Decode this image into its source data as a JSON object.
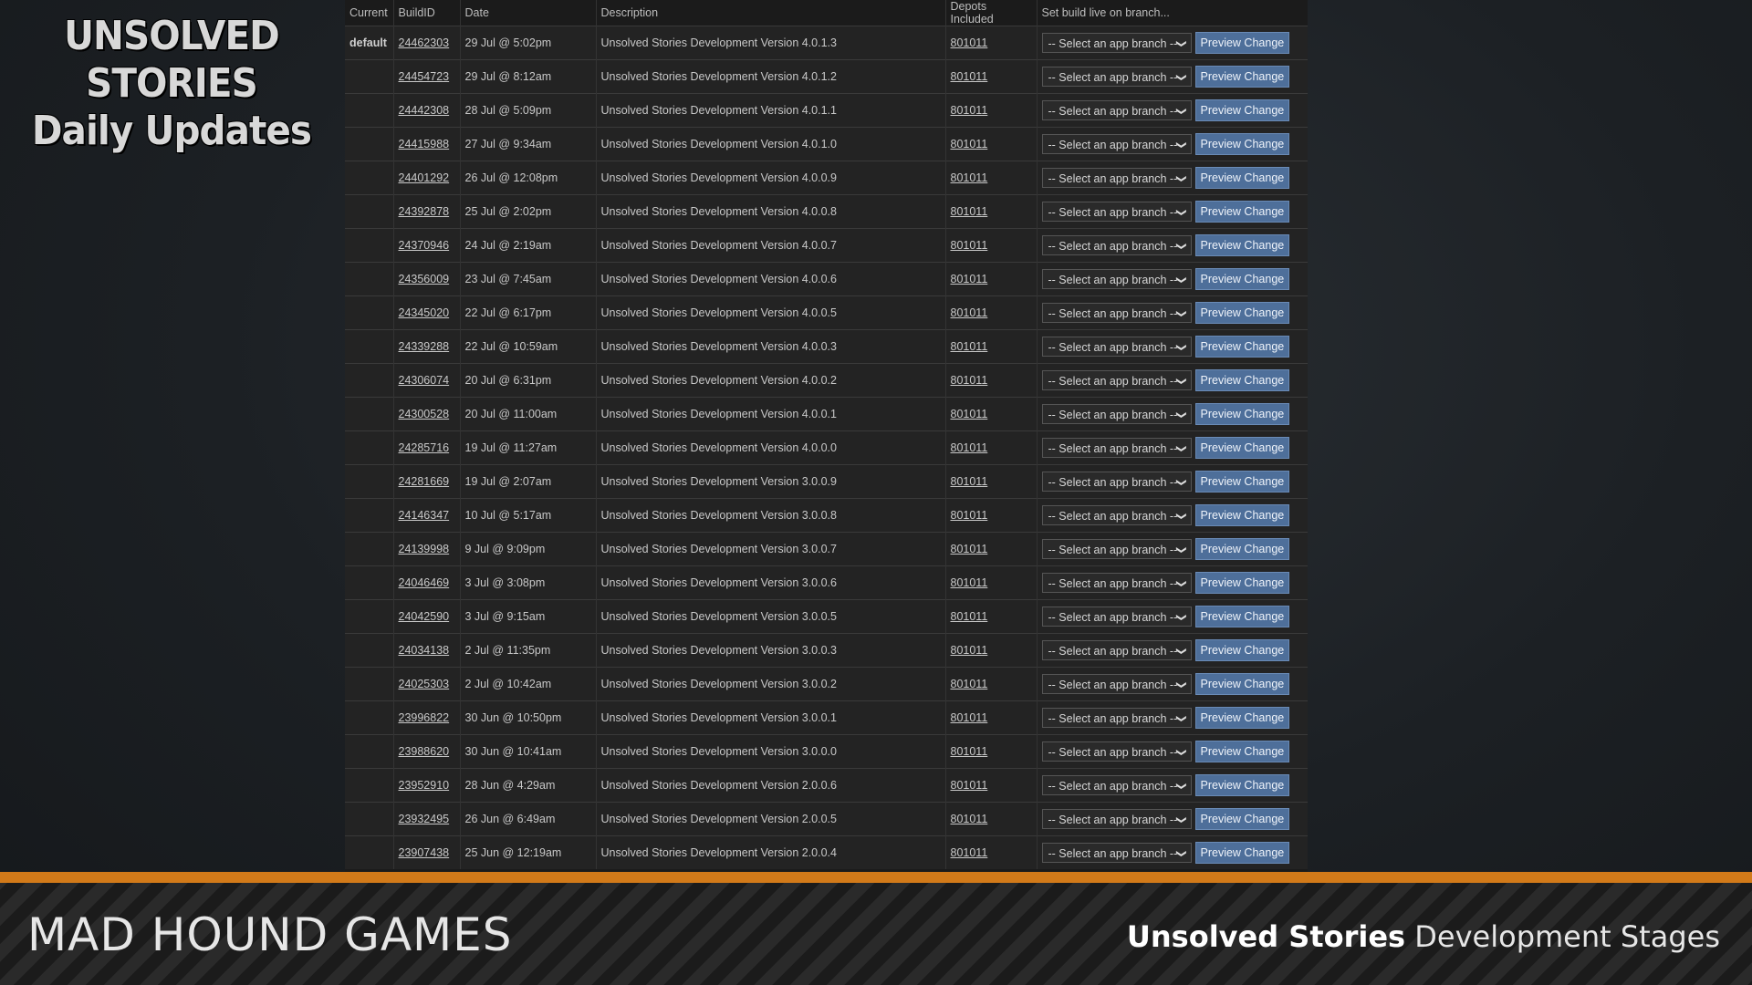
{
  "brand": {
    "line1": "UNSOLVED STORIES",
    "line2": "Daily Updates"
  },
  "table": {
    "headers": [
      "Current",
      "BuildID",
      "Date",
      "Description",
      "Depots Included",
      "Set build live on branch..."
    ],
    "select_placeholder": "-- Select an app branch --",
    "button_label": "Preview Change",
    "rows": [
      {
        "current": "default",
        "build": "24462303",
        "date": "29 Jul @ 5:02pm",
        "desc": "Unsolved Stories Development Version 4.0.1.3",
        "depot": "801011"
      },
      {
        "current": "",
        "build": "24454723",
        "date": "29 Jul @ 8:12am",
        "desc": "Unsolved Stories Development Version 4.0.1.2",
        "depot": "801011"
      },
      {
        "current": "",
        "build": "24442308",
        "date": "28 Jul @ 5:09pm",
        "desc": "Unsolved Stories Development Version 4.0.1.1",
        "depot": "801011"
      },
      {
        "current": "",
        "build": "24415988",
        "date": "27 Jul @ 9:34am",
        "desc": "Unsolved Stories Development Version 4.0.1.0",
        "depot": "801011"
      },
      {
        "current": "",
        "build": "24401292",
        "date": "26 Jul @ 12:08pm",
        "desc": "Unsolved Stories Development Version 4.0.0.9",
        "depot": "801011"
      },
      {
        "current": "",
        "build": "24392878",
        "date": "25 Jul @ 2:02pm",
        "desc": "Unsolved Stories Development Version 4.0.0.8",
        "depot": "801011"
      },
      {
        "current": "",
        "build": "24370946",
        "date": "24 Jul @ 2:19am",
        "desc": "Unsolved Stories Development Version 4.0.0.7",
        "depot": "801011"
      },
      {
        "current": "",
        "build": "24356009",
        "date": "23 Jul @ 7:45am",
        "desc": "Unsolved Stories Development Version 4.0.0.6",
        "depot": "801011"
      },
      {
        "current": "",
        "build": "24345020",
        "date": "22 Jul @ 6:17pm",
        "desc": "Unsolved Stories Development Version 4.0.0.5",
        "depot": "801011"
      },
      {
        "current": "",
        "build": "24339288",
        "date": "22 Jul @ 10:59am",
        "desc": "Unsolved Stories Development Version 4.0.0.3",
        "depot": "801011"
      },
      {
        "current": "",
        "build": "24306074",
        "date": "20 Jul @ 6:31pm",
        "desc": "Unsolved Stories Development Version 4.0.0.2",
        "depot": "801011"
      },
      {
        "current": "",
        "build": "24300528",
        "date": "20 Jul @ 11:00am",
        "desc": "Unsolved Stories Development Version 4.0.0.1",
        "depot": "801011"
      },
      {
        "current": "",
        "build": "24285716",
        "date": "19 Jul @ 11:27am",
        "desc": "Unsolved Stories Development Version 4.0.0.0",
        "depot": "801011"
      },
      {
        "current": "",
        "build": "24281669",
        "date": "19 Jul @ 2:07am",
        "desc": "Unsolved Stories Development Version 3.0.0.9",
        "depot": "801011"
      },
      {
        "current": "",
        "build": "24146347",
        "date": "10 Jul @ 5:17am",
        "desc": "Unsolved Stories Development Version 3.0.0.8",
        "depot": "801011"
      },
      {
        "current": "",
        "build": "24139998",
        "date": "9 Jul @ 9:09pm",
        "desc": "Unsolved Stories Development Version 3.0.0.7",
        "depot": "801011"
      },
      {
        "current": "",
        "build": "24046469",
        "date": "3 Jul @ 3:08pm",
        "desc": "Unsolved Stories Development Version 3.0.0.6",
        "depot": "801011"
      },
      {
        "current": "",
        "build": "24042590",
        "date": "3 Jul @ 9:15am",
        "desc": "Unsolved Stories Development Version 3.0.0.5",
        "depot": "801011"
      },
      {
        "current": "",
        "build": "24034138",
        "date": "2 Jul @ 11:35pm",
        "desc": "Unsolved Stories Development Version 3.0.0.3",
        "depot": "801011"
      },
      {
        "current": "",
        "build": "24025303",
        "date": "2 Jul @ 10:42am",
        "desc": "Unsolved Stories Development Version 3.0.0.2",
        "depot": "801011"
      },
      {
        "current": "",
        "build": "23996822",
        "date": "30 Jun @ 10:50pm",
        "desc": "Unsolved Stories Development Version 3.0.0.1",
        "depot": "801011"
      },
      {
        "current": "",
        "build": "23988620",
        "date": "30 Jun @ 10:41am",
        "desc": "Unsolved Stories Development Version 3.0.0.0",
        "depot": "801011"
      },
      {
        "current": "",
        "build": "23952910",
        "date": "28 Jun @ 4:29am",
        "desc": "Unsolved Stories Development Version 2.0.0.6",
        "depot": "801011"
      },
      {
        "current": "",
        "build": "23932495",
        "date": "26 Jun @ 6:49am",
        "desc": "Unsolved Stories Development Version 2.0.0.5",
        "depot": "801011"
      },
      {
        "current": "",
        "build": "23907438",
        "date": "25 Jun @ 12:19am",
        "desc": "Unsolved Stories Development Version 2.0.0.4",
        "depot": "801011"
      }
    ]
  },
  "footer": {
    "company": "MAD HOUND GAMES",
    "subtitle_bold": "Unsolved Stories",
    "subtitle_rest": " Development Stages",
    "accent_color": "#d27a19"
  }
}
